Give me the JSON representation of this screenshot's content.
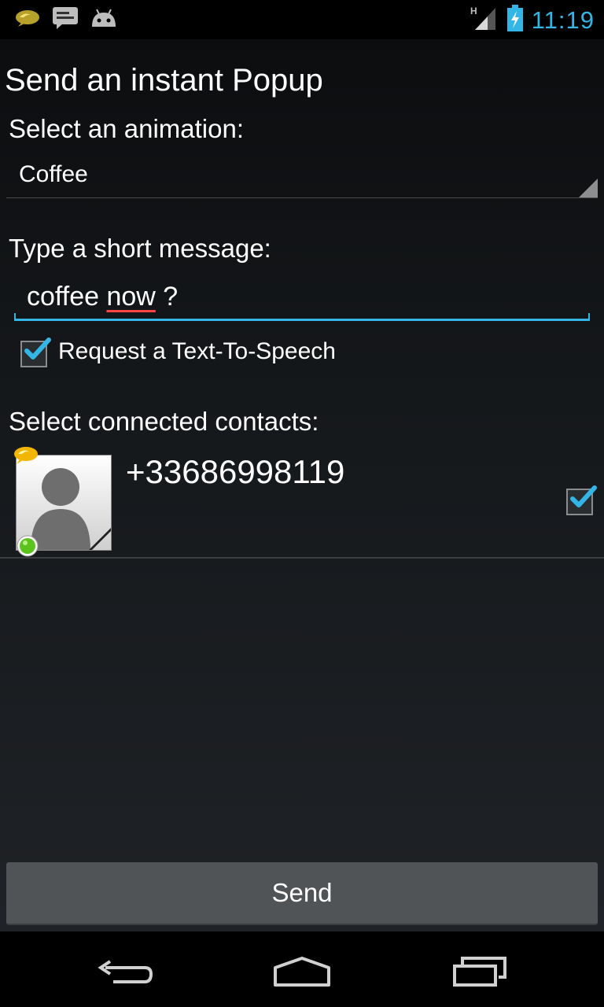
{
  "status_bar": {
    "notification_icons": [
      "popup-app-icon",
      "sms-icon",
      "android-icon"
    ],
    "network_type": "H",
    "time": "11:19",
    "colors": {
      "clock": "#33b5e5"
    }
  },
  "screen": {
    "title": "Send an instant Popup",
    "animation_label": "Select an animation:",
    "animation_selected": "Coffee",
    "message_label": "Type a short message:",
    "message_value_before": "coffee ",
    "message_value_misspelled": "now",
    "message_value_after": " ?",
    "tts_checked": true,
    "tts_label": "Request a Text-To-Speech",
    "contacts_label": "Select connected contacts:",
    "contacts": [
      {
        "number": "+33686998119",
        "online": true,
        "checked": true
      }
    ],
    "send_label": "Send"
  },
  "nav_bar": {
    "icons": [
      "back-icon",
      "home-icon",
      "recent-apps-icon"
    ]
  },
  "colors": {
    "accent": "#33b5e5",
    "spellcheck": "#ff4444",
    "online": "#5cc21c"
  }
}
